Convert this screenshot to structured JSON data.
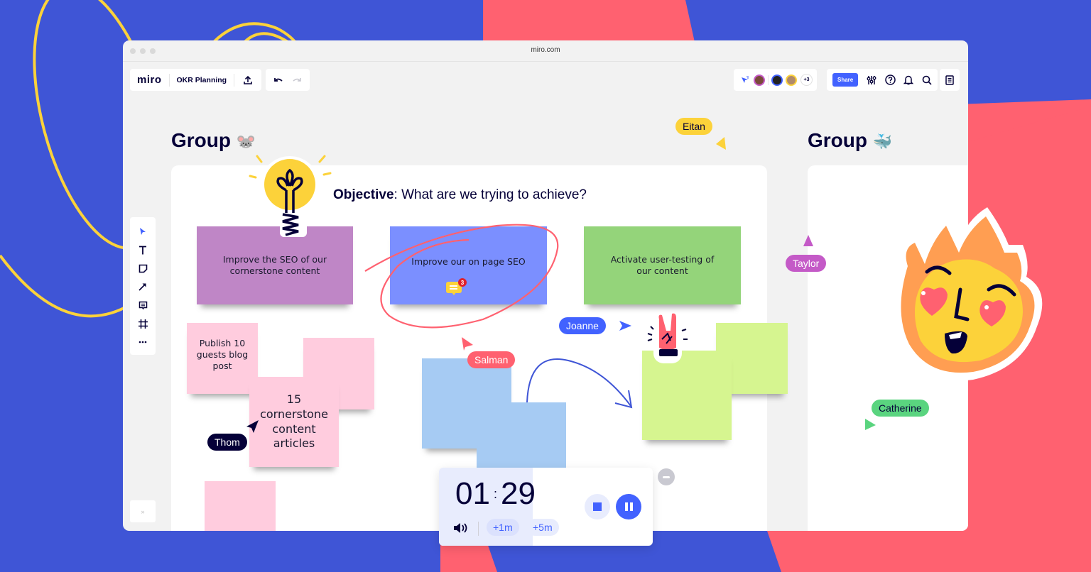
{
  "browser": {
    "url": "miro.com"
  },
  "topbar": {
    "logo": "miro",
    "board_name": "OKR Planning",
    "icons": [
      "upload-icon",
      "undo-icon",
      "redo-icon"
    ]
  },
  "collab": {
    "extra_count": "+3",
    "share_label": "Share",
    "icons": [
      "follow-cursor-icon",
      "settings-sliders-icon",
      "help-icon",
      "bell-icon",
      "search-icon",
      "notes-icon"
    ]
  },
  "toolbar": {
    "tools": [
      "select-icon",
      "text-icon",
      "sticky-note-icon",
      "arrow-icon",
      "comment-icon",
      "frame-icon",
      "more-icon"
    ],
    "expand_label": "»"
  },
  "groups": [
    {
      "title": "Group",
      "emoji": "🐭"
    },
    {
      "title": "Group",
      "emoji": "🐳"
    }
  ],
  "objective": {
    "label": "Objective",
    "text": ": What are we trying to achieve?"
  },
  "stickies": [
    {
      "text": "Improve the SEO of our cornerstone content",
      "color": "#bf86c6"
    },
    {
      "text": "Improve our on page SEO",
      "color": "#7b8fff"
    },
    {
      "text": "Activate user-testing of our content",
      "color": "#94d47a"
    },
    {
      "text": "Publish 10 guests blog post",
      "color": "#ffccde"
    },
    {
      "text": "",
      "color": "#ffccde"
    },
    {
      "text": "15 cornerstone content articles",
      "color": "#ffccde"
    },
    {
      "text": "",
      "color": "#ffccde"
    },
    {
      "text": "",
      "color": "#a6cbf3"
    },
    {
      "text": "",
      "color": "#a6cbf3"
    },
    {
      "text": "",
      "color": "#d6f590"
    },
    {
      "text": "",
      "color": "#d6f590"
    }
  ],
  "comment_badge": {
    "count": "3"
  },
  "cursors": [
    {
      "name": "Eitan",
      "color": "#fcd23a",
      "text_color": "#050038"
    },
    {
      "name": "Taylor",
      "color": "#c45ac7",
      "text_color": "#ffffff"
    },
    {
      "name": "Joanne",
      "color": "#4262ff",
      "text_color": "#ffffff"
    },
    {
      "name": "Salman",
      "color": "#ff6170",
      "text_color": "#ffffff"
    },
    {
      "name": "Thom",
      "color": "#050038",
      "text_color": "#ffffff"
    },
    {
      "name": "Catherine",
      "color": "#5ad47f",
      "text_color": "#050038"
    }
  ],
  "timer": {
    "minutes": "01",
    "seconds": "29",
    "add_1": "+1m",
    "add_5": "+5m",
    "elapsed_fraction": 0.44
  },
  "colors": {
    "brand_blue": "#4262ff",
    "background_blue": "#3f55d6",
    "background_red": "#ff6170",
    "accent_yellow": "#fcd23a"
  }
}
